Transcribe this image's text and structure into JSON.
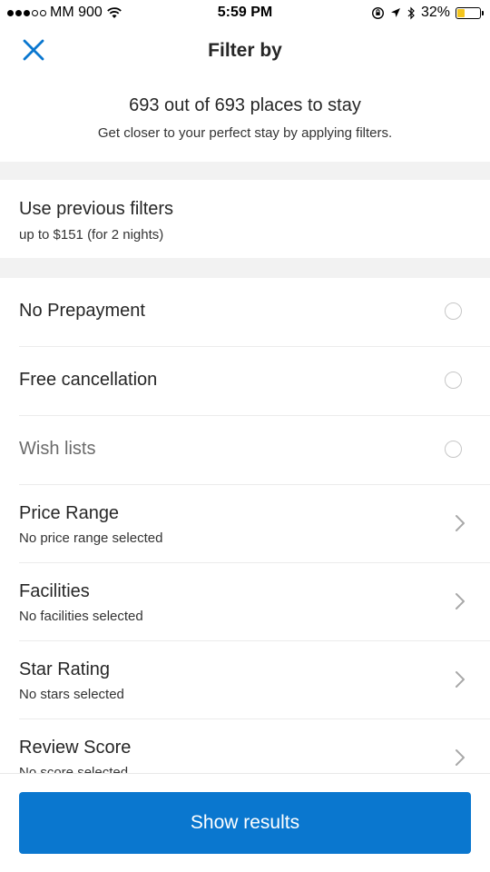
{
  "status_bar": {
    "carrier": "MM 900",
    "time": "5:59 PM",
    "battery_percent": "32%",
    "battery_level": 0.32,
    "battery_color": "#f4c51c",
    "signal_filled": 3,
    "signal_total": 5
  },
  "header": {
    "title": "Filter by",
    "close_icon": "close-icon"
  },
  "summary": {
    "count_text": "693 out of 693 places to stay",
    "hint": "Get closer to your perfect stay by applying filters."
  },
  "previous_filters": {
    "title": "Use previous filters",
    "subtitle": "up to $151 (for 2 nights)"
  },
  "filters": {
    "no_prepayment": {
      "label": "No Prepayment",
      "selected": false
    },
    "free_cancellation": {
      "label": "Free cancellation",
      "selected": false
    },
    "wish_lists": {
      "label": "Wish lists",
      "selected": false
    },
    "price_range": {
      "label": "Price Range",
      "value": "No price range selected"
    },
    "facilities": {
      "label": "Facilities",
      "value": "No facilities selected"
    },
    "star_rating": {
      "label": "Star Rating",
      "value": "No stars selected"
    },
    "review_score": {
      "label": "Review Score",
      "value": "No score selected"
    }
  },
  "actions": {
    "show_results": "Show results"
  },
  "colors": {
    "accent": "#0a77cf",
    "section_gap": "#f2f2f2"
  }
}
